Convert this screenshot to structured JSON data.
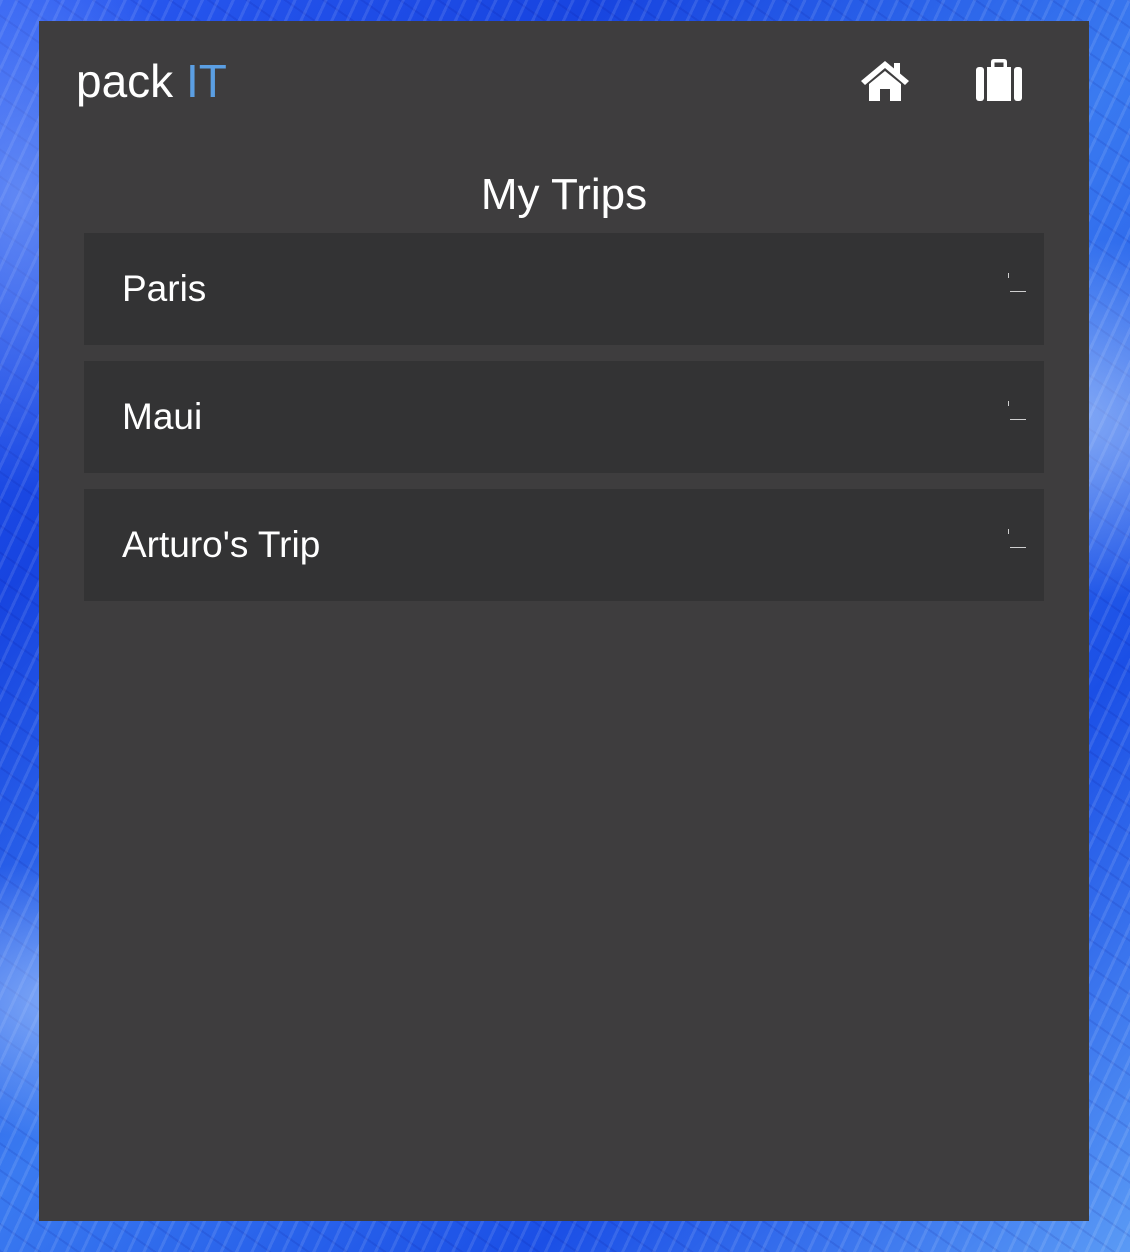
{
  "app": {
    "brand_main": "pack",
    "brand_accent": "IT",
    "accent_color": "#5b9fe3",
    "panel_color": "#3e3d3e",
    "row_color": "#333334"
  },
  "nav": {
    "home_icon": "home-icon",
    "trips_icon": "suitcase-icon"
  },
  "page": {
    "title": "My Trips"
  },
  "trips": [
    {
      "name": "Paris"
    },
    {
      "name": "Maui"
    },
    {
      "name": "Arturo's Trip"
    }
  ]
}
